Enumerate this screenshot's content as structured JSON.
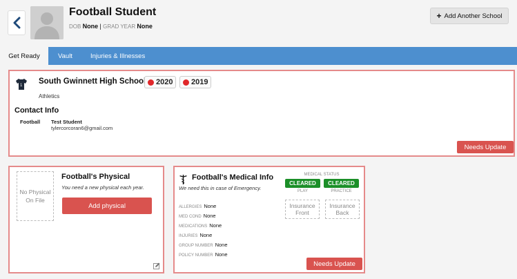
{
  "header": {
    "student_name": "Football Student",
    "dob_label": "DOB",
    "dob_value": "None",
    "grad_year_label": "GRAD YEAR",
    "grad_year_value": "None",
    "add_school_label": "Add Another School"
  },
  "tabs": [
    {
      "label": "Get Ready",
      "active": true
    },
    {
      "label": "Vault",
      "active": false
    },
    {
      "label": "Injuries & Illnesses",
      "active": false
    }
  ],
  "school": {
    "name": "South Gwinnett High School",
    "years": [
      "2020",
      "2019"
    ],
    "sport": "Athletics",
    "contact_title": "Contact Info",
    "contact_sport": "Football",
    "contact_name": "Test Student",
    "contact_email": "tylercorcoran6@gmail.com",
    "needs_update_label": "Needs Update"
  },
  "physical": {
    "placeholder": "No Physical On File",
    "title": "Football's Physical",
    "description": "You need a new physical each year.",
    "add_label": "Add physical"
  },
  "medical": {
    "title": "Football's Medical Info",
    "description": "We need this in case of Emergency.",
    "status_label": "MEDICAL STATUS",
    "play_status": "CLEARED",
    "play_label": "PLAY",
    "practice_status": "CLEARED",
    "practice_label": "PRACTICE",
    "insurance_front": "Insurance Front",
    "insurance_back": "Insurance Back",
    "fields": [
      {
        "label": "ALLERGIES",
        "value": "None"
      },
      {
        "label": "MED COND",
        "value": "None"
      },
      {
        "label": "MEDICATIONS",
        "value": "None"
      },
      {
        "label": "INJURIES",
        "value": "None"
      },
      {
        "label": "GROUP NUMBER",
        "value": "None"
      },
      {
        "label": "POLICY NUMBER",
        "value": "None"
      }
    ],
    "needs_update_label": "Needs Update"
  },
  "colors": {
    "tab_bar": "#4d8fcf",
    "card_border": "#e58a8a",
    "danger": "#d9534f",
    "cleared": "#1b8f28",
    "year_dot": "#e0272a"
  },
  "icons": [
    "back-chevron-icon",
    "avatar-placeholder-icon",
    "plus-icon",
    "jersey-icon",
    "caduceus-icon",
    "edit-icon"
  ]
}
